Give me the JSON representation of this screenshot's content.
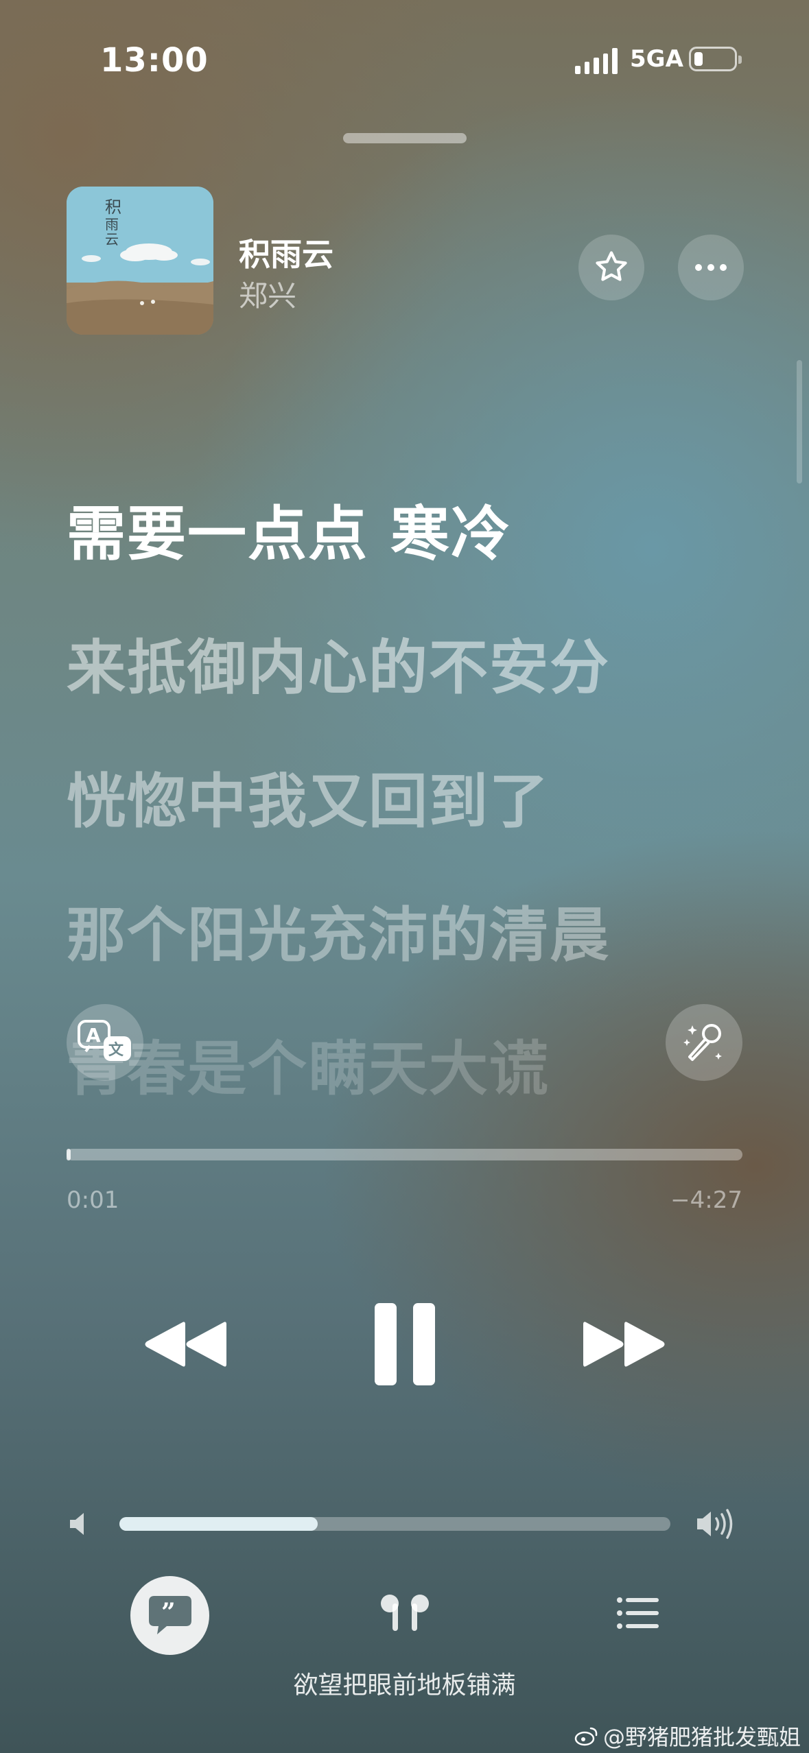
{
  "status_bar": {
    "time": "13:00",
    "network": "5GA",
    "signal_bars": 5,
    "battery_level": 0.12
  },
  "now_playing": {
    "title": "积雨云",
    "artist": "郑兴",
    "album_art": {
      "icon": "album-art",
      "lettering": "积雨云"
    }
  },
  "lyrics": {
    "lines": [
      "需要一点点 寒冷",
      "来抵御内心的不安分",
      "恍惚中我又回到了",
      "那个阳光充沛的清晨",
      "青春是个瞒天大谎"
    ],
    "current_index": 0
  },
  "side_buttons": {
    "translate": "translate-icon",
    "sing": "microphone-sparkle-icon"
  },
  "playback": {
    "elapsed": "0:01",
    "remaining": "−4:27",
    "progress": 0.004
  },
  "controls": {
    "rewind": "rewind-icon",
    "play_state": "pause-icon",
    "forward": "fast-forward-icon"
  },
  "volume": {
    "level": 0.36
  },
  "bottom_bar": {
    "lyrics_icon": "lyrics-quote-icon",
    "airplay_icon": "airpods-icon",
    "queue_icon": "queue-list-icon",
    "output_caption": "欲望把眼前地板铺满"
  },
  "watermark": "@野猪肥猪批发甄姐"
}
